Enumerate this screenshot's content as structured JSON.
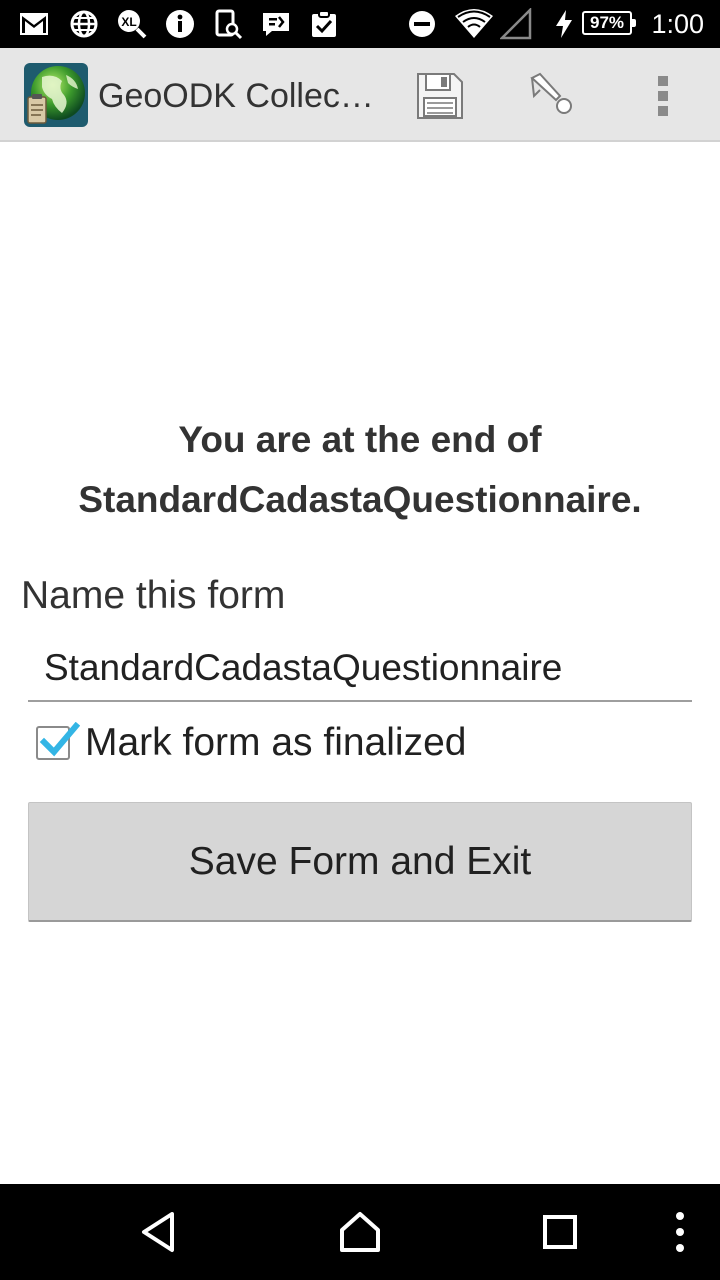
{
  "status_bar": {
    "time": "1:00",
    "battery_percent": "97%",
    "icons": [
      "gmail-icon",
      "globe-icon",
      "xl-search-icon",
      "info-icon",
      "screenshot-search-icon",
      "message-icon",
      "clipboard-check-icon",
      "do-not-disturb-icon",
      "wifi-icon",
      "no-signal-icon",
      "charging-icon",
      "battery-icon"
    ]
  },
  "action_bar": {
    "app_title": "GeoODK Collec…",
    "icons": [
      "app-logo",
      "save-icon",
      "go-to-prompt-icon",
      "overflow-menu-icon"
    ]
  },
  "content": {
    "end_message": "You are at the end of StandardCadastaQuestionnaire.",
    "name_label": "Name this form",
    "name_value": "StandardCadastaQuestionnaire",
    "mark_finalized_label": "Mark form as finalized",
    "mark_finalized_checked": true,
    "save_button_label": "Save Form and Exit",
    "accent_color": "#33b5e5"
  },
  "nav_bar": {
    "icons": [
      "back-icon",
      "home-icon",
      "recents-icon",
      "overflow-icon"
    ]
  }
}
